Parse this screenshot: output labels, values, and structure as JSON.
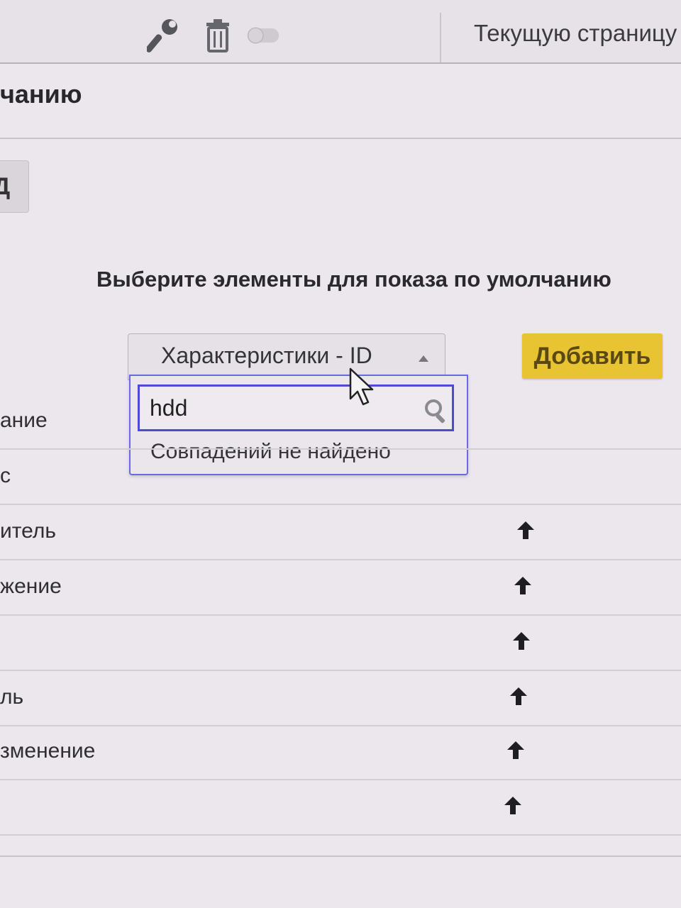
{
  "toolbar": {
    "icons": [
      "wrench-icon",
      "trash-icon",
      "toggle-icon"
    ],
    "current_page_label": "Текущую страницу"
  },
  "section_heading": "чанию",
  "left_button_label": "Д",
  "choose_heading": "Выберите элементы для показа по умолчанию",
  "select": {
    "value": "Характеристики - ID",
    "search_value": "hdd",
    "no_results_text": "Совпадений не найдено"
  },
  "add_button_label": "Добавить",
  "rows": [
    {
      "label": "ание",
      "has_arrow": false
    },
    {
      "label": "с",
      "has_arrow": false
    },
    {
      "label": "итель",
      "has_arrow": true
    },
    {
      "label": "жение",
      "has_arrow": true
    },
    {
      "label": "",
      "has_arrow": true
    },
    {
      "label": "ль",
      "has_arrow": true
    },
    {
      "label": "зменение",
      "has_arrow": true
    },
    {
      "label": "",
      "has_arrow": true
    }
  ],
  "colors": {
    "background": "#ece7ec",
    "add_button": "#e8c432",
    "focus_border": "#4b4bd6"
  }
}
